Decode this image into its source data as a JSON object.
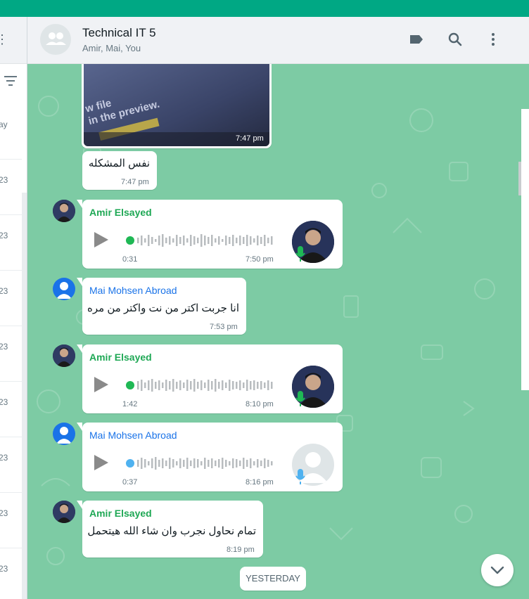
{
  "chat": {
    "title": "Technical IT 5",
    "participants": "Amir, Mai, You"
  },
  "header_icons": [
    "label-icon",
    "search-icon",
    "menu-icon"
  ],
  "sidebar": {
    "row_snippets": [
      "ay",
      "23",
      "23",
      "23",
      "23",
      "23",
      "23",
      "23",
      "23"
    ]
  },
  "messages": [
    {
      "type": "image",
      "time": "7:47 pm",
      "image_text": "w file in the preview."
    },
    {
      "type": "text",
      "text": "نفس المشكله",
      "time": "7:47 pm"
    },
    {
      "type": "voice",
      "sender": "Amir Elsayed",
      "duration": "0:31",
      "time": "7:50 pm",
      "progress": 0
    },
    {
      "type": "text",
      "sender": "Mai Mohsen Abroad",
      "text": "انا جربت اكتر من نت واكتر من مره",
      "time": "7:53 pm"
    },
    {
      "type": "voice",
      "sender": "Amir Elsayed",
      "duration": "1:42",
      "time": "8:10 pm",
      "progress": 0
    },
    {
      "type": "voice",
      "sender": "Mai Mohsen Abroad",
      "duration": "0:37",
      "time": "8:16 pm",
      "progress": 0
    },
    {
      "type": "text",
      "sender": "Amir Elsayed",
      "text": "تمام نحاول نجرب وان شاء الله هيتحمل",
      "time": "8:19 pm"
    }
  ],
  "date_divider": "YESTERDAY",
  "colors": {
    "accent": "#00a884",
    "chat_background": "#7dcba4",
    "amir_name": "#1fa855",
    "mai_name": "#1a73e8",
    "voice_dot_green": "#1fb855",
    "voice_dot_blue": "#4fb2f0"
  }
}
